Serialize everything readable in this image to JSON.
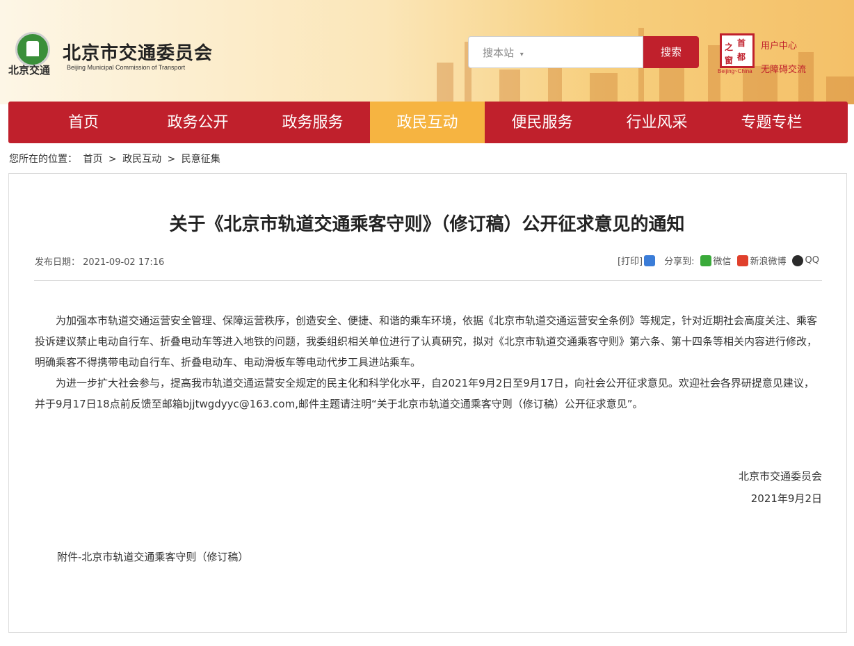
{
  "header": {
    "logo_small": "北京交通",
    "site_title": "北京市交通委员会",
    "site_title_en": "Beijing Municipal Commission of Transport",
    "search_placeholder": "搜本站",
    "search_button": "搜索",
    "badge_chars": [
      "首",
      "都",
      "之",
      "窗"
    ],
    "badge_en": "Beijing~China",
    "user_center": "用户中心",
    "accessibility": "无障碍交流"
  },
  "nav": {
    "items": [
      "首页",
      "政务公开",
      "政务服务",
      "政民互动",
      "便民服务",
      "行业风采",
      "专题专栏"
    ],
    "active_index": 3
  },
  "breadcrumb": {
    "prefix": "您所在的位置：",
    "items": [
      "首页",
      "政民互动",
      "民意征集"
    ],
    "separator": ">"
  },
  "article": {
    "title": "关于《北京市轨道交通乘客守则》（修订稿）公开征求意见的通知",
    "date_label": "发布日期：",
    "date": "2021-09-02 17:16",
    "print": "[打印]",
    "share_label": "分享到:",
    "share_wechat": "微信",
    "share_weibo": "新浪微博",
    "share_qq": "QQ",
    "paragraphs": [
      "为加强本市轨道交通运营安全管理、保障运营秩序，创造安全、便捷、和谐的乘车环境，依据《北京市轨道交通运营安全条例》等规定，针对近期社会高度关注、乘客投诉建议禁止电动自行车、折叠电动车等进入地铁的问题，我委组织相关单位进行了认真研究，拟对《北京市轨道交通乘客守则》第六条、第十四条等相关内容进行修改，明确乘客不得携带电动自行车、折叠电动车、电动滑板车等电动代步工具进站乘车。",
      "为进一步扩大社会参与，提高我市轨道交通运营安全规定的民主化和科学化水平，自2021年9月2日至9月17日，向社会公开征求意见。欢迎社会各界研提意见建议，并于9月17日18点前反馈至邮箱bjjtwgdyyc@163.com,邮件主题请注明“关于北京市轨道交通乘客守则（修订稿）公开征求意见”。"
    ],
    "signature": "北京市交通委员会",
    "sign_date": "2021年9月2日",
    "attachment": "附件-北京市轨道交通乘客守则（修订稿）"
  },
  "colors": {
    "brand_red": "#c0202c",
    "nav_active": "#f6b441",
    "logo_green": "#3a8f3a"
  }
}
